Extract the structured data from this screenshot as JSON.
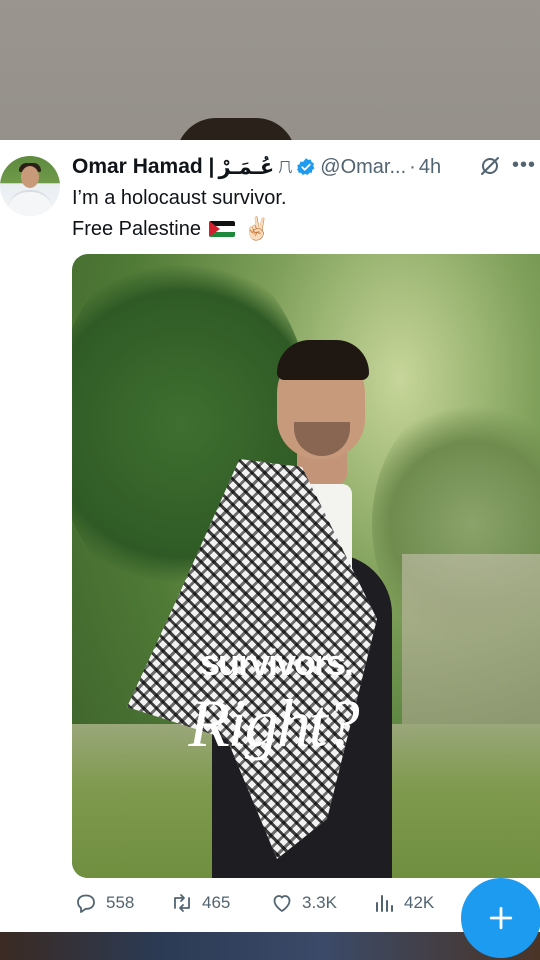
{
  "tweet": {
    "display_name": "Omar Hamad |",
    "display_name_ar": "عُـمَـرْ",
    "handle": "@Omar...",
    "separator": "·",
    "time": "4h",
    "text_line1": "I’m a holocaust survivor.",
    "text_line2": "Free Palestine",
    "victory_emoji": "✌🏻",
    "image_overlay_top": "survivors.",
    "image_overlay_bottom": "Right?",
    "verified_color": "#1d9bf0",
    "icons": {
      "verified": "verified-badge-icon",
      "grok": "grok-icon",
      "more": "more-icon"
    }
  },
  "actions": {
    "replies": "558",
    "reposts": "465",
    "likes": "3.3K",
    "views": "42K"
  },
  "fab": {
    "icon": "compose-plus-icon",
    "color": "#1d9bf0"
  }
}
